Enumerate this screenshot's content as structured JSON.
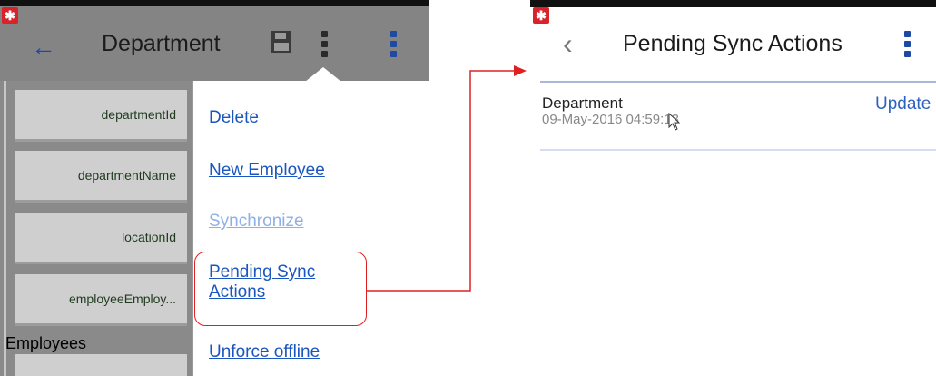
{
  "left": {
    "header": {
      "title": "Department",
      "back_icon": "arrow-left-icon",
      "save_icon": "save-icon",
      "menu_icon": "more-vert-icon"
    },
    "fields": [
      {
        "label": "departmentId"
      },
      {
        "label": "departmentName"
      },
      {
        "label": "locationId"
      },
      {
        "label": "employeeEmploy..."
      }
    ],
    "section_label": "Employees",
    "menu": {
      "items": [
        {
          "label": "Delete",
          "enabled": true
        },
        {
          "label": "New Employee",
          "enabled": true
        },
        {
          "label": "Synchronize",
          "enabled": false
        },
        {
          "label": "Pending Sync\nActions",
          "enabled": true,
          "highlighted": true
        },
        {
          "label": "Unforce offline",
          "enabled": true
        }
      ]
    }
  },
  "right": {
    "header": {
      "title": "Pending Sync Actions",
      "back_icon": "chevron-left-icon",
      "menu_icon": "more-vert-icon"
    },
    "actions": [
      {
        "name": "Department",
        "timestamp": "09-May-2016 04:59:13",
        "type": "Update"
      }
    ]
  },
  "colors": {
    "accent": "#1b56c0",
    "highlight": "#e02020",
    "menu_dot": "#1e4aa3"
  }
}
